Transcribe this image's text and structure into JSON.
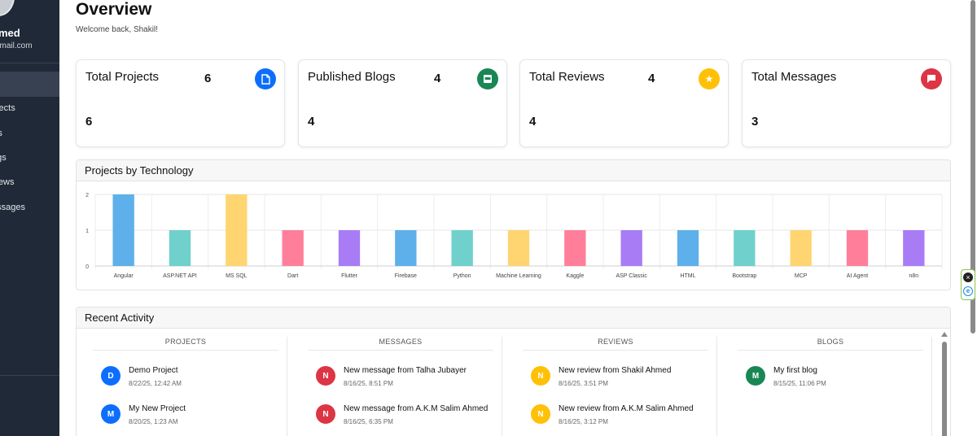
{
  "sidebar": {
    "user_name": "hmed",
    "user_email": "gmail.com",
    "nav": [
      "ojects",
      "ills",
      "ogs",
      "views",
      "essages"
    ]
  },
  "header": {
    "title": "Overview",
    "subtitle": "Welcome back, Shakil!"
  },
  "stats": [
    {
      "label": "Total Projects",
      "inline_value": "6",
      "value": "6",
      "icon": "file-icon",
      "color": "#0d6efd"
    },
    {
      "label": "Published Blogs",
      "inline_value": "4",
      "value": "4",
      "icon": "blog-icon",
      "color": "#198754"
    },
    {
      "label": "Total Reviews",
      "inline_value": "4",
      "value": "4",
      "icon": "star-icon",
      "color": "#ffc107"
    },
    {
      "label": "Total Messages",
      "value": "3",
      "icon": "message-icon",
      "color": "#dc3545"
    }
  ],
  "chart_panel_title": "Projects by Technology",
  "chart_data": {
    "type": "bar",
    "categories": [
      "Angular",
      "ASP.NET API",
      "MS SQL",
      "Dart",
      "Flutter",
      "Firebase",
      "Python",
      "Machine Learning",
      "Kaggle",
      "ASP Classic",
      "HTML",
      "Bootstrap",
      "MCP",
      "AI Agent",
      "n8n"
    ],
    "values": [
      2,
      1,
      2,
      1,
      1,
      1,
      1,
      1,
      1,
      1,
      1,
      1,
      1,
      1,
      1
    ],
    "colors": [
      "#5eb0ea",
      "#6fd0cc",
      "#ffd572",
      "#ff7f9a",
      "#a87cf5",
      "#5eb0ea",
      "#6fd0cc",
      "#ffd572",
      "#ff7f9a",
      "#a87cf5",
      "#5eb0ea",
      "#6fd0cc",
      "#ffd572",
      "#ff7f9a",
      "#a87cf5"
    ],
    "ylim": [
      0,
      2
    ],
    "yticks": [
      "2",
      "1",
      "0"
    ],
    "grid": true
  },
  "activity": {
    "title": "Recent Activity",
    "columns": [
      {
        "heading": "PROJECTS",
        "items": [
          {
            "initial": "D",
            "title": "Demo Project",
            "time": "8/22/25, 12:42 AM",
            "color": "#0d6efd"
          },
          {
            "initial": "M",
            "title": "My New Project",
            "time": "8/20/25, 1:23 AM",
            "color": "#0d6efd"
          }
        ]
      },
      {
        "heading": "MESSAGES",
        "items": [
          {
            "initial": "N",
            "title": "New message from Talha Jubayer",
            "time": "8/16/25, 8:51 PM",
            "color": "#dc3545"
          },
          {
            "initial": "N",
            "title": "New message from A.K.M Salim Ahmed",
            "time": "8/16/25, 6:35 PM",
            "color": "#dc3545"
          }
        ]
      },
      {
        "heading": "REVIEWS",
        "items": [
          {
            "initial": "N",
            "title": "New review from Shakil Ahmed",
            "time": "8/16/25, 3:51 PM",
            "color": "#ffc107"
          },
          {
            "initial": "N",
            "title": "New review from A.K.M Salim Ahmed",
            "time": "8/16/25, 3:12 PM",
            "color": "#ffc107"
          }
        ]
      },
      {
        "heading": "BLOGS",
        "items": [
          {
            "initial": "M",
            "title": "My first blog",
            "time": "8/15/25, 11:06 PM",
            "color": "#198754"
          }
        ]
      }
    ]
  }
}
